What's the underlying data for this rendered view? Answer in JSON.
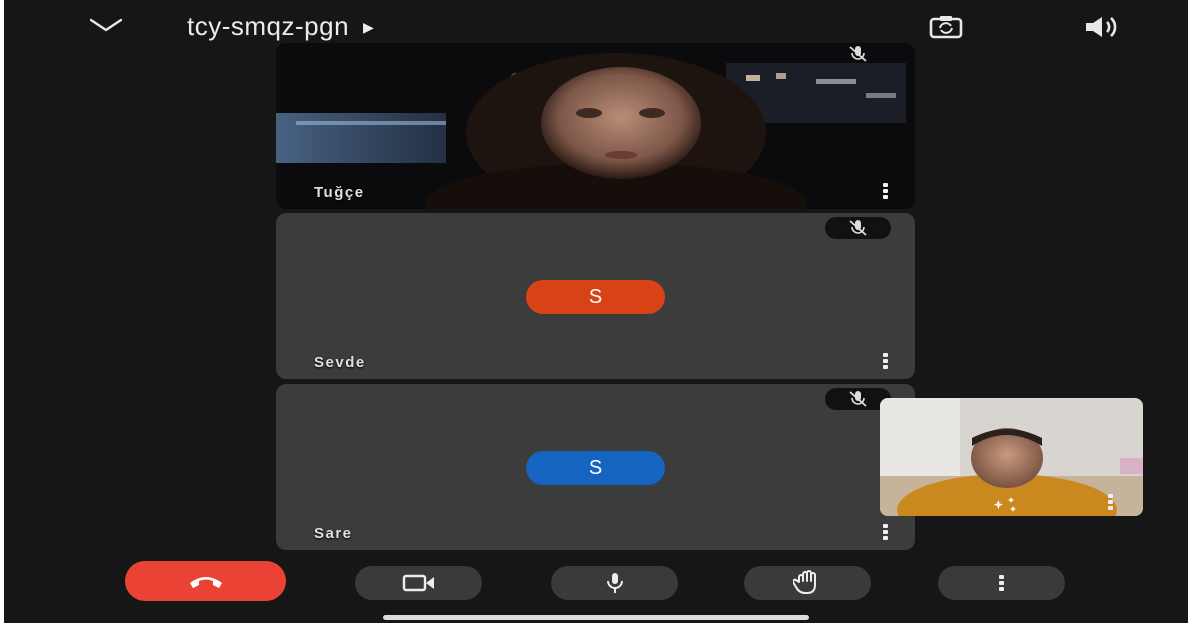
{
  "topbar": {
    "meeting_code": "tcy-smqz-pgn",
    "collapse_icon": "chevron-down-icon",
    "switch_camera_icon": "switch-camera-icon",
    "speaker_icon": "speaker-icon"
  },
  "participants": [
    {
      "name": "Tuğçe",
      "type": "video",
      "muted": true
    },
    {
      "name": "Sevde",
      "initial": "S",
      "avatar_color": "#d84315",
      "muted": true
    },
    {
      "name": "Sare",
      "initial": "S",
      "avatar_color": "#1565c0",
      "muted": true
    }
  ],
  "self_view": {
    "effects_icon": "sparkle-icon",
    "menu_icon": "more-vert-icon"
  },
  "controls": [
    {
      "name": "end-call",
      "icon": "phone-hangup-icon",
      "color": "#ea4335"
    },
    {
      "name": "camera",
      "icon": "video-camera-icon"
    },
    {
      "name": "microphone",
      "icon": "microphone-icon"
    },
    {
      "name": "raise-hand",
      "icon": "hand-icon"
    },
    {
      "name": "more-options",
      "icon": "more-vert-icon"
    }
  ],
  "colors": {
    "background": "#161616",
    "tile": "#3c3c3c",
    "end_call": "#ea4335"
  }
}
